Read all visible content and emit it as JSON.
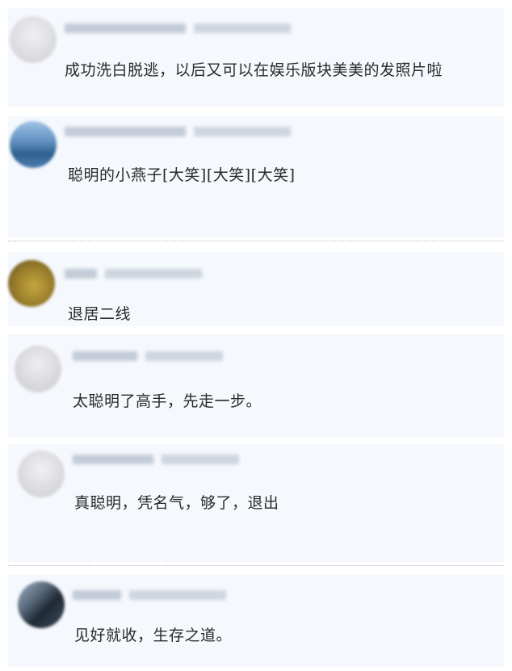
{
  "comments": [
    {
      "text": "成功洗白脱逃，以后又可以在娱乐版块美美的发照片啦",
      "avatar_colors": [
        "#e8e8ea",
        "#d2d2d6"
      ]
    },
    {
      "text": "聪明的小燕子[大笑][大笑][大笑]",
      "avatar_colors": [
        "#7aa9d6",
        "#3c6f9f"
      ]
    },
    {
      "text": "退居二线",
      "avatar_colors": [
        "#b79a3a",
        "#6e5a22"
      ]
    },
    {
      "text": "太聪明了高手，先走一步。",
      "avatar_colors": [
        "#e3e3e6",
        "#c9c9ce"
      ]
    },
    {
      "text": "真聪明，凭名气，够了，退出",
      "avatar_colors": [
        "#e6e6e9",
        "#cfcfd4"
      ]
    },
    {
      "text": "见好就收，生存之道。",
      "avatar_colors": [
        "#5b6b7e",
        "#1f2a35"
      ]
    }
  ]
}
